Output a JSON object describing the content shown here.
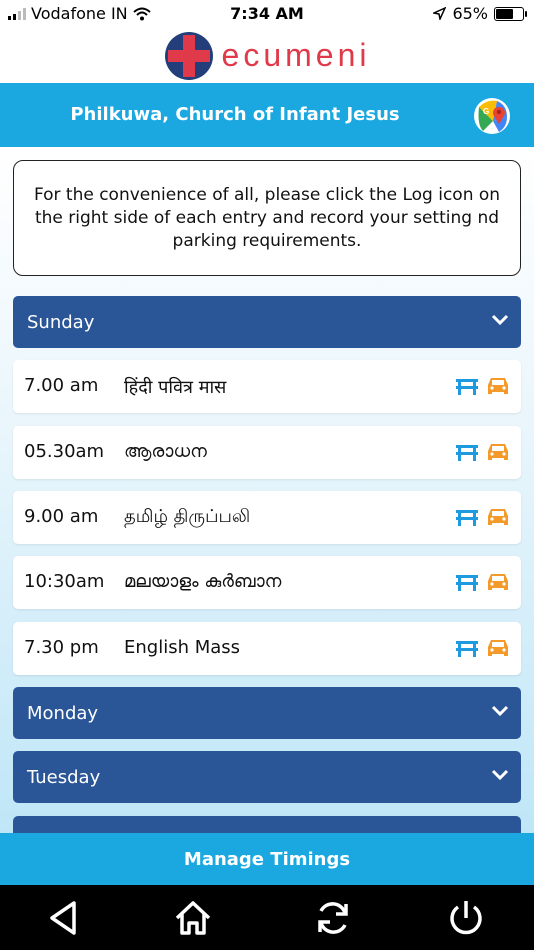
{
  "status_bar": {
    "carrier": "Vodafone IN",
    "time": "7:34 AM",
    "battery": "65%",
    "battery_level": 0.65
  },
  "logo": {
    "text": "ecumeni"
  },
  "header": {
    "title": "Philkuwa, Church of Infant Jesus"
  },
  "notice": {
    "text": "For the convenience of all, please click the Log icon on the right side of each entry and record your setting nd parking requirements."
  },
  "days": [
    {
      "label": "Sunday"
    },
    {
      "label": "Monday"
    },
    {
      "label": "Tuesday"
    }
  ],
  "entries": [
    {
      "time": "7.00 am",
      "name": "हिंदी पवित्र मास"
    },
    {
      "time": "05.30am",
      "name": "ആരാധന"
    },
    {
      "time": "9.00 am",
      "name": "தமிழ் திருப்பலி"
    },
    {
      "time": "10:30am",
      "name": "മലയാളം കുർബാന"
    },
    {
      "time": "7.30 pm",
      "name": "English Mass"
    }
  ],
  "footer": {
    "manage_label": "Manage Timings"
  },
  "colors": {
    "header": "#1ba8e0",
    "day_bar": "#2a5597",
    "logo_red": "#e03a4a",
    "bench_blue": "#1e9be0",
    "car_orange": "#f39a2b"
  },
  "icons": [
    "wifi-icon",
    "location-arrow-icon",
    "google-maps-icon",
    "chevron-down-icon",
    "bench-icon",
    "car-icon",
    "back-icon",
    "home-icon",
    "refresh-icon",
    "power-icon"
  ]
}
